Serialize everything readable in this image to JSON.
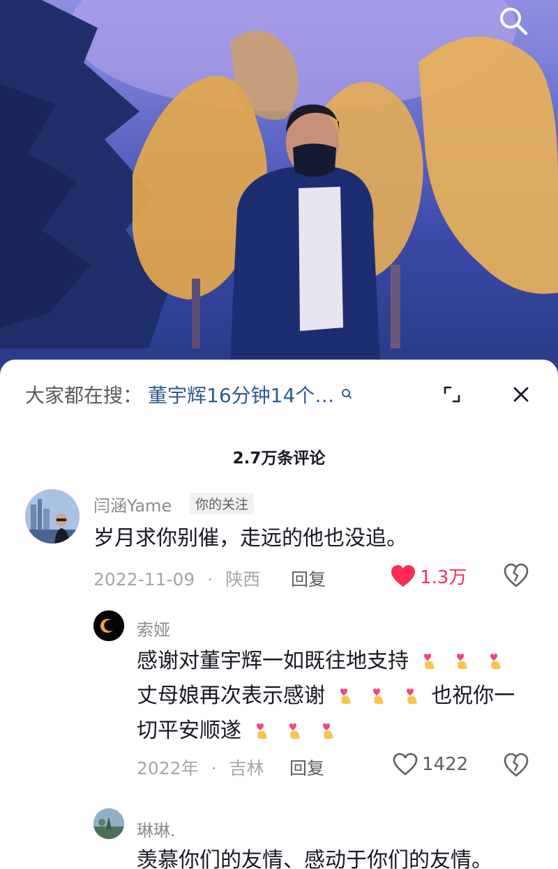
{
  "video": {
    "description_icon": "search-icon"
  },
  "sheet": {
    "suggest_prefix": "大家都在搜：",
    "suggest_query": "董宇辉16分钟14个…",
    "comment_count": "2.7万条评论"
  },
  "comments": [
    {
      "user": "闫涵Yame",
      "tag": "你的关注",
      "text": "岁月求你别催，走远的他也没追。",
      "date": "2022-11-09",
      "sep": "·",
      "location": "陕西",
      "reply": "回复",
      "likes": "1.3万",
      "liked": true
    },
    {
      "user": "索娅",
      "text_line1": "感谢对董宇辉一如既往地支持",
      "text_line2a": "丈母娘再次表示感谢",
      "text_line2b": "也祝你一",
      "text_line3": "切平安顺遂",
      "date": "2022年",
      "sep": "·",
      "location": "吉林",
      "reply": "回复",
      "likes": "1422",
      "liked": false
    },
    {
      "user": "琳琳.",
      "text": "羡慕你们的友情、感动于你们的友情。"
    }
  ],
  "colors": {
    "liked": "#fe2c55",
    "link": "#2f5a8a",
    "muted": "#a5a6ab"
  }
}
